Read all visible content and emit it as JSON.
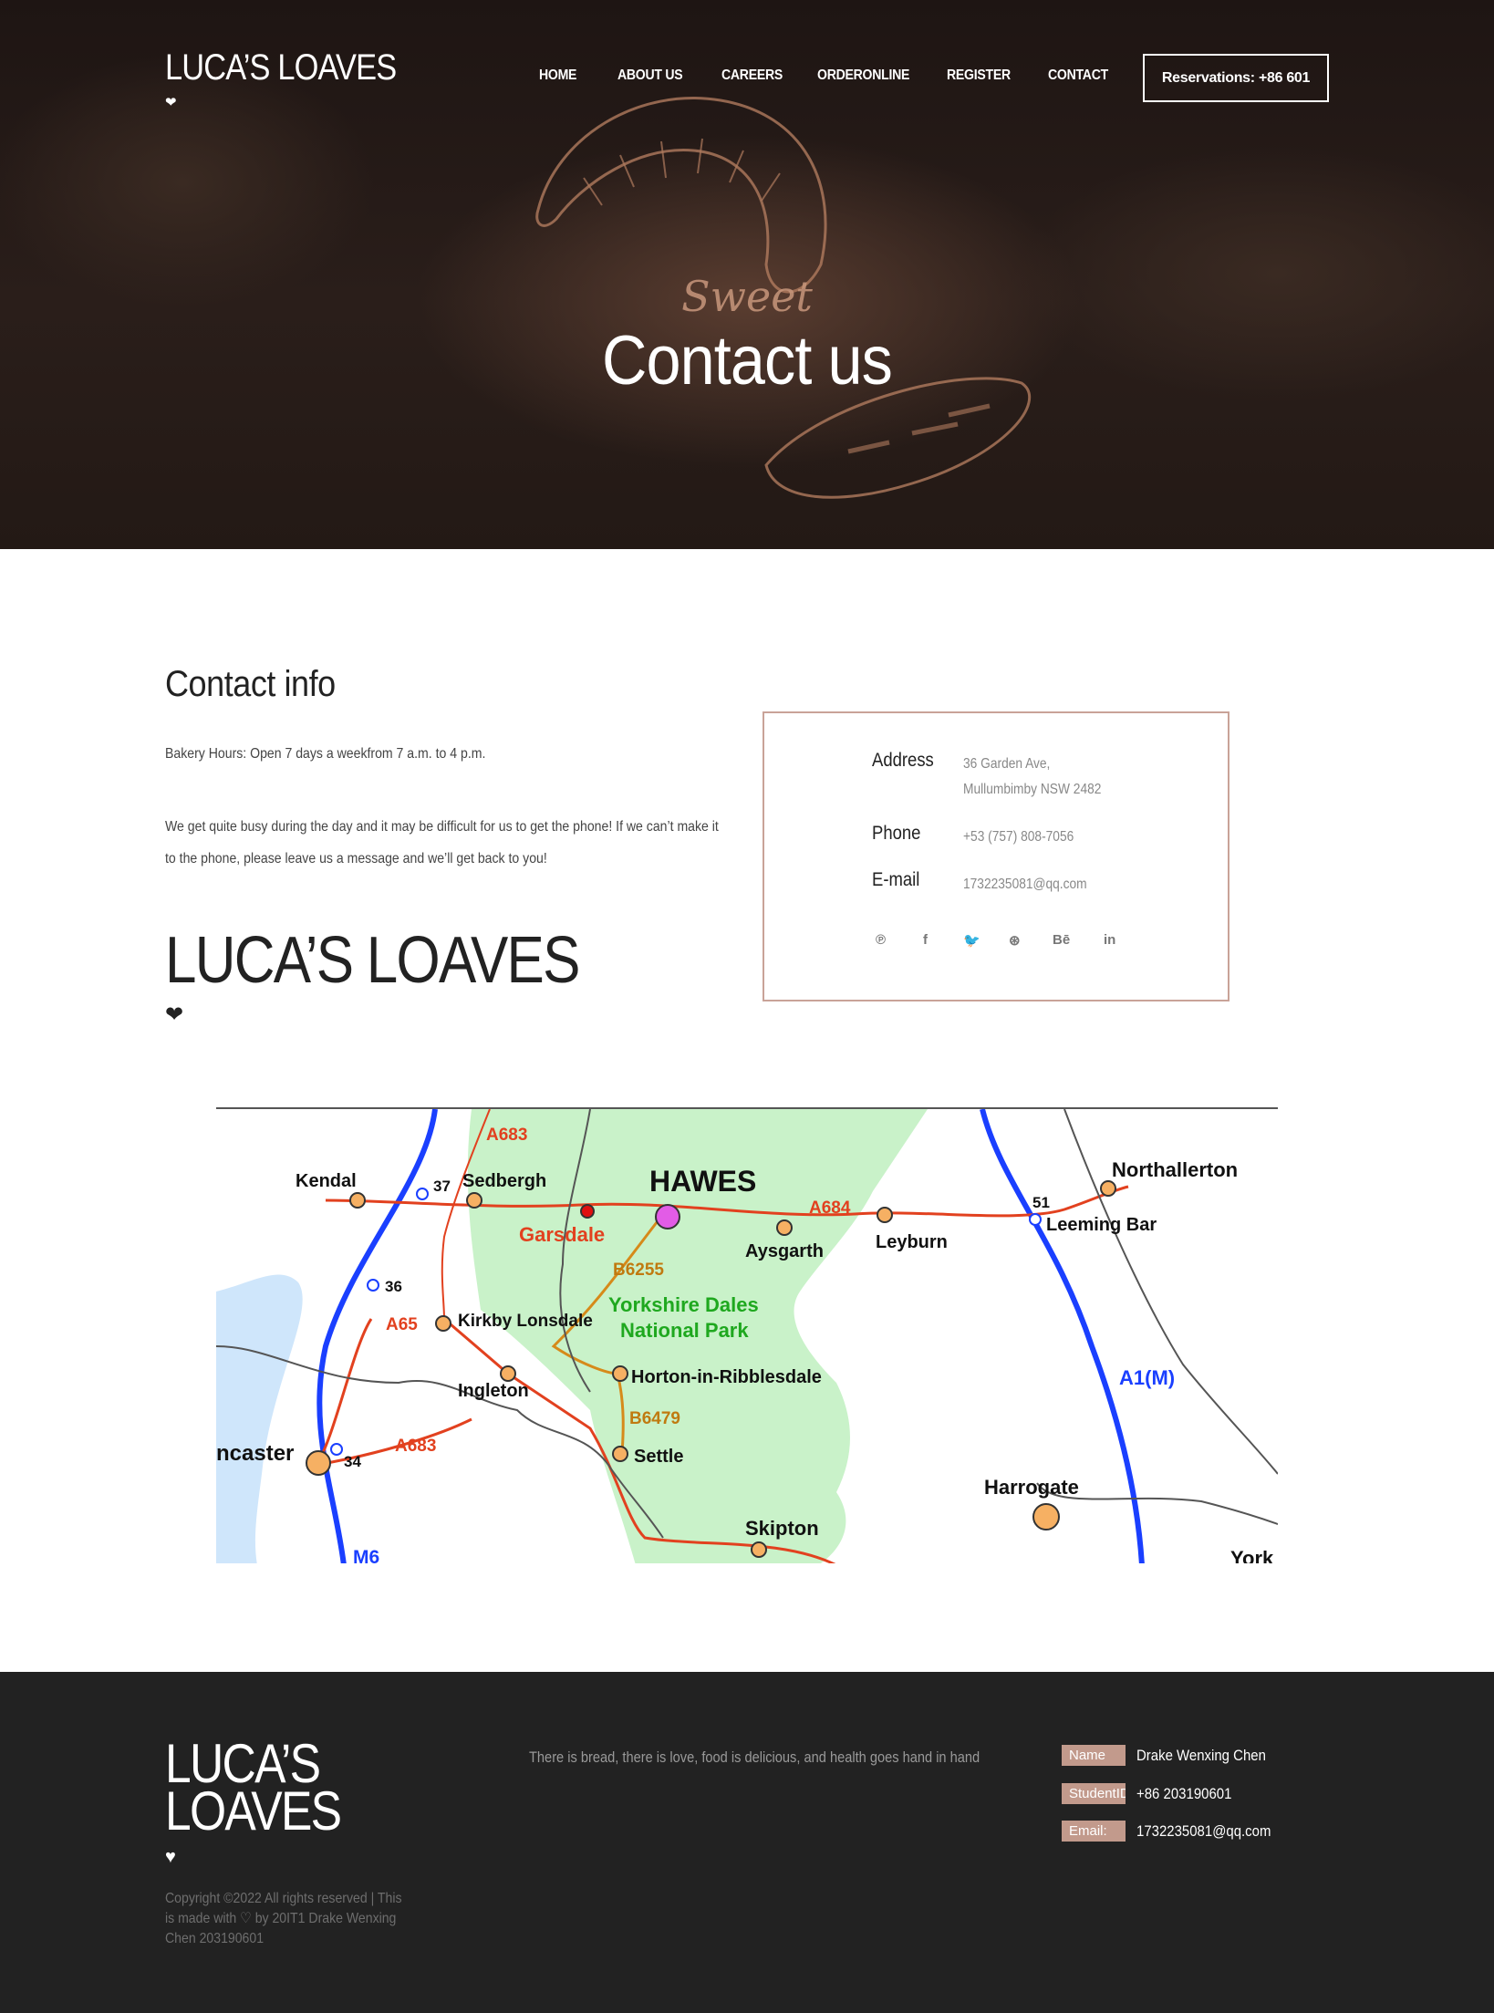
{
  "header": {
    "logo": "LUCA’S LOAVES",
    "heart": "❤",
    "nav": [
      "HOME",
      "ABOUT US",
      "CAREERS",
      "ORDERONLINE",
      "REGISTER",
      "CONTACT"
    ],
    "reservation": "Reservations: +86 601"
  },
  "hero": {
    "script": "Sweet",
    "title": "Contact us"
  },
  "contact_info": {
    "title": "Contact info",
    "hours": "Bakery Hours: Open 7 days a weekfrom 7 a.m. to 4 p.m.",
    "message": "We get quite busy during the day and it may be difficult for us to get the phone! If we can’t make it to the phone, please leave us a message and we’ll get back to you!",
    "logo": "LUCA’S LOAVES",
    "heart": "❤"
  },
  "details": {
    "address_label": "Address",
    "address_line1": "36 Garden Ave,",
    "address_line2": "Mullumbimby NSW 2482",
    "phone_label": "Phone",
    "phone": "+53 (757) 808-7056",
    "email_label": "E-mail",
    "email": "1732235081@qq.com",
    "social": [
      "pinterest-icon",
      "facebook-icon",
      "twitter-icon",
      "dribbble-icon",
      "behance-icon",
      "linkedin-icon"
    ]
  },
  "map": {
    "labels": [
      "HAWES",
      "Kendal",
      "Sedbergh",
      "Garsdale",
      "Aysgarth",
      "Leyburn",
      "Northallerton",
      "Leeming Bar",
      "Kirkby Lonsdale",
      "Ingleton",
      "Horton-in-Ribblesdale",
      "Settle",
      "Skipton",
      "Harrogate",
      "ncaster",
      "Yorkshire Dales",
      "National Park",
      "A683",
      "A684",
      "A65",
      "B6255",
      "B6479",
      "A1(M)",
      "M6",
      "37",
      "36",
      "34",
      "51",
      "York"
    ]
  },
  "footer": {
    "logo_line1": "LUCA’S",
    "logo_line2": "LOAVES",
    "heart": "♥",
    "copyright": "Copyright ©2022 All rights reserved | This is made with ♡ by 20IT1 Drake Wenxing Chen 203190601",
    "tagline": "There is bread, there is love, food is delicious, and health goes hand in hand",
    "name_label": "Name",
    "name": "Drake Wenxing Chen",
    "id_label": "StudentID:",
    "id": "+86 203190601",
    "email_label": "Email:",
    "email": "1732235081@qq.com"
  }
}
